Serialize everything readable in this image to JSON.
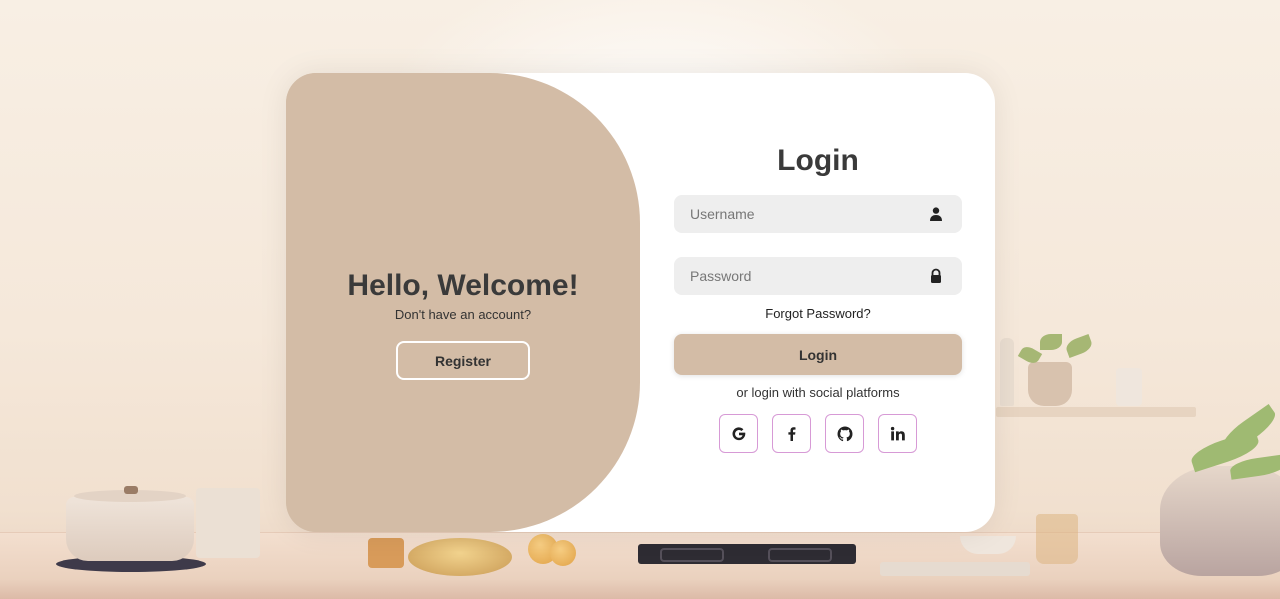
{
  "welcome": {
    "title": "Hello, Welcome!",
    "subtitle": "Don't have an account?",
    "register_label": "Register"
  },
  "login": {
    "title": "Login",
    "username_placeholder": "Username",
    "username_icon": "user-icon",
    "password_placeholder": "Password",
    "password_icon": "lock-icon",
    "forgot_label": "Forgot Password?",
    "login_label": "Login",
    "social_text": "or login with social platforms",
    "social": [
      {
        "name": "google",
        "icon": "google-icon"
      },
      {
        "name": "facebook",
        "icon": "facebook-icon"
      },
      {
        "name": "github",
        "icon": "github-icon"
      },
      {
        "name": "linkedin",
        "icon": "linkedin-icon"
      }
    ]
  },
  "colors": {
    "accent": "#d3bca6",
    "card": "#ffffff",
    "input_bg": "#eeeeee",
    "social_border": "#d79ad6",
    "text": "#3a3a3a"
  }
}
